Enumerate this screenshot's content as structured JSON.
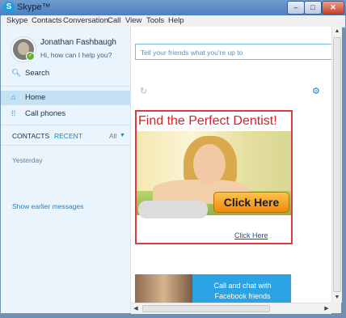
{
  "window": {
    "title": "Skype™",
    "logo_letter": "S",
    "controls": {
      "minimize": "–",
      "maximize": "□",
      "close": "✕"
    }
  },
  "menu": [
    "Skype",
    "Contacts",
    "Conversation",
    "Call",
    "View",
    "Tools",
    "Help"
  ],
  "profile": {
    "name": "Jonathan Fashbaugh",
    "mood": "Hi, how can I help you?",
    "status": "online"
  },
  "nav": {
    "search": {
      "icon": "search-icon",
      "label": "Search"
    },
    "home": {
      "icon": "home-icon",
      "label": "Home"
    },
    "call_phones": {
      "icon": "dialpad-icon",
      "label": "Call phones"
    }
  },
  "tabs": {
    "contacts": "CONTACTS",
    "recent": "RECENT",
    "filter": "All"
  },
  "recent": {
    "section": "Yesterday",
    "show_earlier": "Show earlier messages"
  },
  "main": {
    "mood_placeholder": "Tell your friends what you're up to"
  },
  "ad": {
    "headline": "Find the Perfect Dentist!",
    "cta": "Click Here",
    "link": "Click Here"
  },
  "fb_promo": {
    "line1": "Call and chat with",
    "line2": "Facebook friends"
  },
  "colors": {
    "accent": "#1a84c8",
    "ad_red": "#d2232a",
    "cta_orange": "#ee8a0e",
    "sidebar": "#e9f4fc",
    "fb_blue": "#2aa2e3"
  }
}
